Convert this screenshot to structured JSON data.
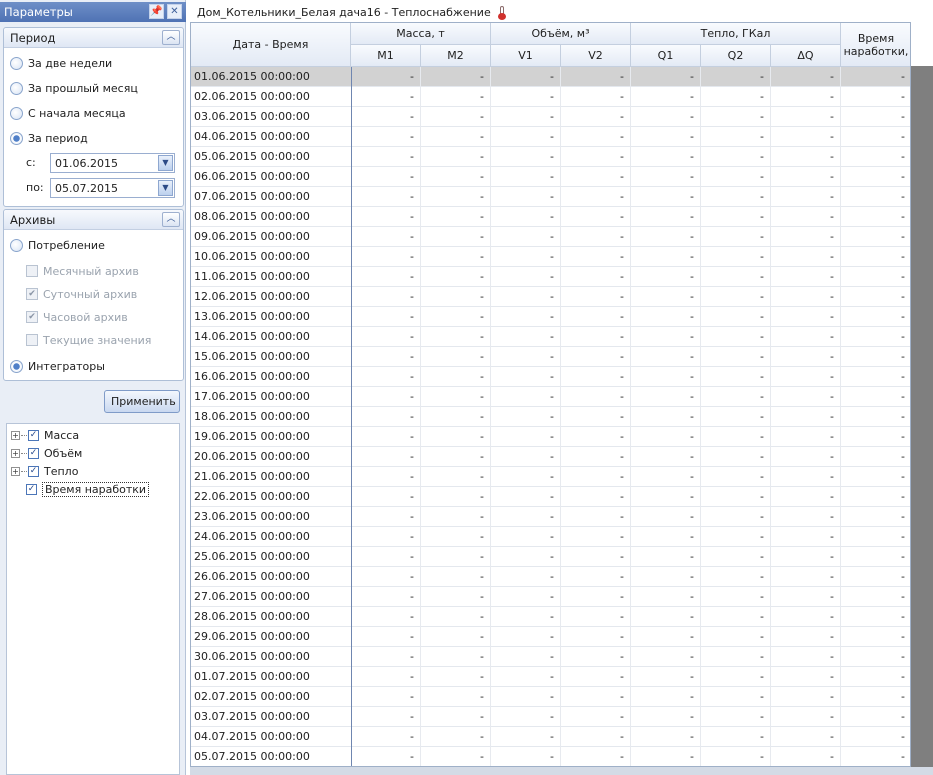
{
  "panel": {
    "title": "Параметры",
    "pin_glyph": "📌",
    "close_glyph": "✕"
  },
  "period": {
    "header": "Период",
    "options": [
      "За две недели",
      "За прошлый месяц",
      "С начала месяца",
      "За период"
    ],
    "selected": "За период",
    "from_label": "с:",
    "from_value": "01.06.2015",
    "to_label": "по:",
    "to_value": "05.07.2015"
  },
  "archives": {
    "header": "Архивы",
    "consumption_label": "Потребление",
    "sub_options": [
      {
        "label": "Месячный архив",
        "checked": false
      },
      {
        "label": "Суточный архив",
        "checked": true
      },
      {
        "label": "Часовой архив",
        "checked": true
      },
      {
        "label": "Текущие значения",
        "checked": false
      }
    ],
    "integrators_label": "Интеграторы",
    "selected": "Интеграторы"
  },
  "apply_label": "Применить",
  "tree": [
    {
      "label": "Масса",
      "expandable": true,
      "checked": true
    },
    {
      "label": "Объём",
      "expandable": true,
      "checked": true
    },
    {
      "label": "Тепло",
      "expandable": true,
      "checked": true
    },
    {
      "label": "Время наработки",
      "expandable": false,
      "checked": true,
      "focused": true
    }
  ],
  "doc_title": "Дом_Котельники_Белая дача16 - Теплоснабжение",
  "doc_icon": "thermometer-icon",
  "grid": {
    "date_header": "Дата - Время",
    "groups": [
      {
        "label": "Масса, т",
        "cols": [
          "M1",
          "M2"
        ]
      },
      {
        "label": "Объём, м³",
        "cols": [
          "V1",
          "V2"
        ]
      },
      {
        "label": "Тепло, ГКал",
        "cols": [
          "Q1",
          "Q2",
          "ΔQ"
        ]
      }
    ],
    "last_header": "Время наработки,",
    "empty_value": "-",
    "rows": [
      "01.06.2015 00:00:00",
      "02.06.2015 00:00:00",
      "03.06.2015 00:00:00",
      "04.06.2015 00:00:00",
      "05.06.2015 00:00:00",
      "06.06.2015 00:00:00",
      "07.06.2015 00:00:00",
      "08.06.2015 00:00:00",
      "09.06.2015 00:00:00",
      "10.06.2015 00:00:00",
      "11.06.2015 00:00:00",
      "12.06.2015 00:00:00",
      "13.06.2015 00:00:00",
      "14.06.2015 00:00:00",
      "15.06.2015 00:00:00",
      "16.06.2015 00:00:00",
      "17.06.2015 00:00:00",
      "18.06.2015 00:00:00",
      "19.06.2015 00:00:00",
      "20.06.2015 00:00:00",
      "21.06.2015 00:00:00",
      "22.06.2015 00:00:00",
      "23.06.2015 00:00:00",
      "24.06.2015 00:00:00",
      "25.06.2015 00:00:00",
      "26.06.2015 00:00:00",
      "27.06.2015 00:00:00",
      "28.06.2015 00:00:00",
      "29.06.2015 00:00:00",
      "30.06.2015 00:00:00",
      "01.07.2015 00:00:00",
      "02.07.2015 00:00:00",
      "03.07.2015 00:00:00",
      "04.07.2015 00:00:00",
      "05.07.2015 00:00:00"
    ],
    "selected_row": 0
  }
}
